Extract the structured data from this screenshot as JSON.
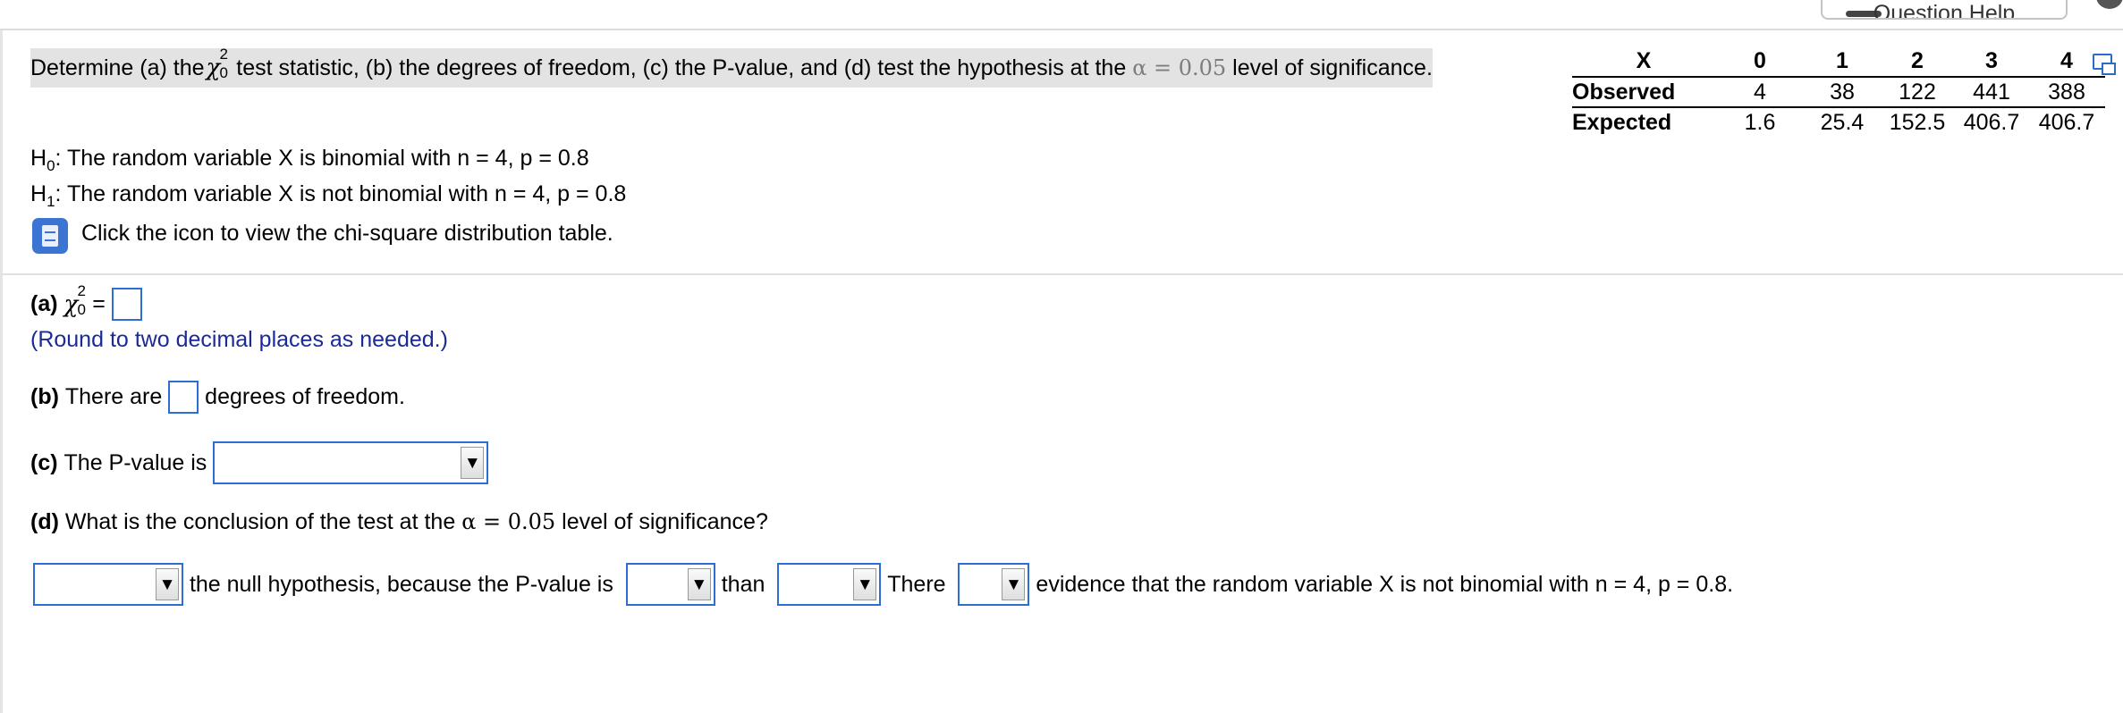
{
  "header": {
    "help_label": "Question Help"
  },
  "question": {
    "part1": "Determine (a) the",
    "chi": "χ",
    "chi_sup": "2",
    "chi_sub": "0",
    "part2": "test statistic, (b) the degrees of freedom, (c) the P-value, and (d) test the hypothesis at the",
    "alpha_expr": "α = 0.05",
    "part3": "level of significance."
  },
  "table": {
    "header_label": "X",
    "x_values": [
      "0",
      "1",
      "2",
      "3",
      "4"
    ],
    "observed_label": "Observed",
    "observed": [
      "4",
      "38",
      "122",
      "441",
      "388"
    ],
    "expected_label": "Expected",
    "expected": [
      "1.6",
      "25.4",
      "152.5",
      "406.7",
      "406.7"
    ]
  },
  "hypotheses": {
    "h0_prefix": "H",
    "h0_sub": "0",
    "h0_text": ": The random variable X is binomial with n = 4, p = 0.8",
    "h1_prefix": "H",
    "h1_sub": "1",
    "h1_text": ": The random variable X is not binomial with n = 4, p = 0.8",
    "table_link": "Click the icon to view the chi-square distribution table."
  },
  "part_a": {
    "label": "(a)",
    "chi": "χ",
    "chi_sup": "2",
    "chi_sub": "0",
    "equals": "=",
    "value": "",
    "note": "(Round to two decimal places as needed.)"
  },
  "part_b": {
    "label": "(b)",
    "before": "There are",
    "value": "",
    "after": "degrees of freedom."
  },
  "part_c": {
    "label": "(c)",
    "text": "The P-value is",
    "selected": ""
  },
  "part_d": {
    "label": "(d)",
    "question_before": "What is the conclusion of the test at the",
    "alpha_expr": "α = 0.05",
    "question_after": "level of significance?",
    "select1": "",
    "text1": "the null hypothesis, because the P-value is",
    "select2": "",
    "text2": "than",
    "select3": "",
    "text3": "There",
    "select4": "",
    "text4": "evidence that the random variable X is not binomial with n = 4, p = 0.8."
  },
  "icons": {
    "dropdown_arrow": "▼",
    "book": "book-icon",
    "copy": "copy-icon"
  },
  "colors": {
    "accent": "#2c6fd0",
    "note": "#1a2a96",
    "highlight": "#e3e3e3"
  }
}
